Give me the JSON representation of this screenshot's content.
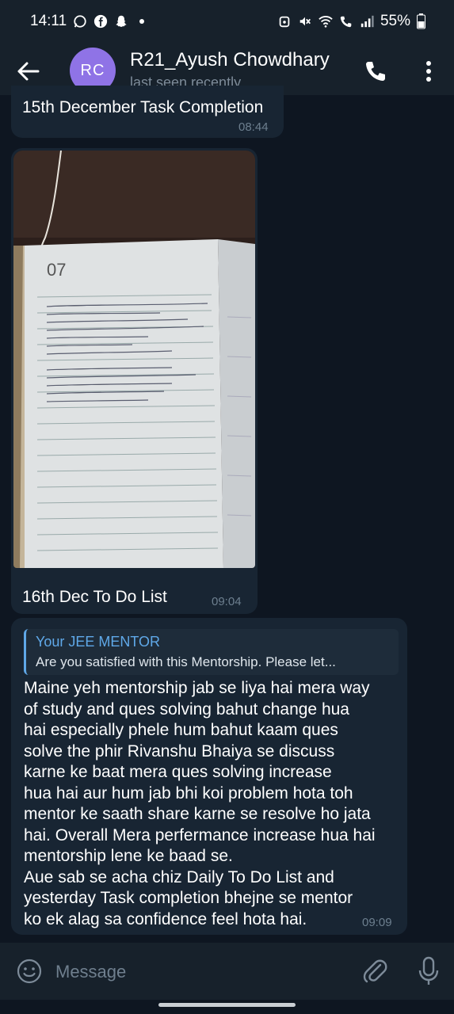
{
  "status_bar": {
    "time": "14:11",
    "battery": "55%",
    "left_icons": [
      "whatsapp-icon",
      "facebook-icon",
      "snapchat-icon"
    ],
    "right_icons": [
      "alarm-icon",
      "mute-icon",
      "wifi-icon",
      "wifi-calling-icon",
      "signal-icon",
      "battery-icon"
    ]
  },
  "header": {
    "avatar_initials": "RC",
    "avatar_color": "#8f73e6",
    "name": "R21_Ayush Chowdhary",
    "status": "last seen recently"
  },
  "messages": [
    {
      "text": "15th December Task Completion",
      "time": "08:44"
    },
    {
      "caption": "16th Dec To Do List",
      "time": "09:04",
      "photo_icon": "notebook-photo"
    },
    {
      "reply": {
        "author": "Your JEE MENTOR",
        "text": "Are you satisfied with this Mentorship. Please let..."
      },
      "text": "Maine yeh mentorship jab se liya hai mera way\nof study and ques solving bahut change hua\nhai especially phele hum bahut kaam ques\nsolve the phir Rivanshu Bhaiya se discuss\nkarne ke baat mera ques solving increase\nhua hai aur hum jab bhi koi problem hota toh\nmentor ke saath share karne se resolve ho jata\nhai. Overall Mera perfermance increase hua hai\nmentorship lene ke baad se.\nAue sab se acha chiz Daily To Do List and\nyesterday Task completion bhejne se mentor\nko ek alag sa confidence feel hota hai.",
      "time": "09:09"
    }
  ],
  "input": {
    "placeholder": "Message"
  },
  "colors": {
    "background": "#0e1621",
    "bubble": "#182533",
    "bar": "#17212b",
    "accent": "#5fa8e8"
  }
}
